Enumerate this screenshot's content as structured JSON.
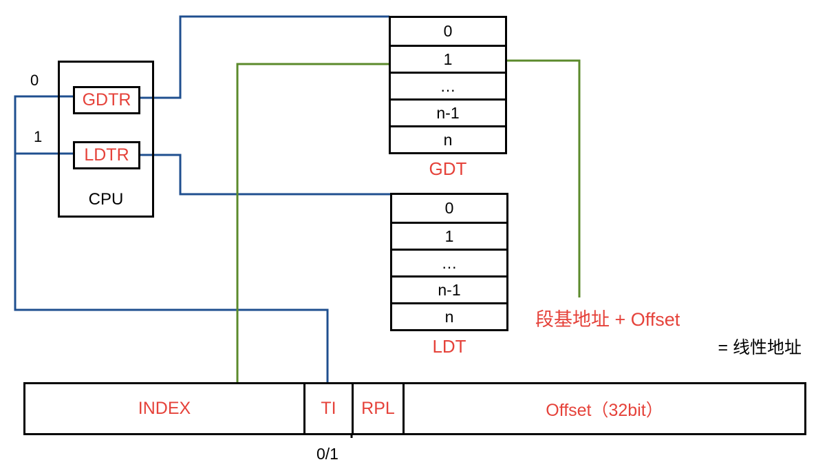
{
  "colors": {
    "label_red": "#e5423a",
    "pointer_blue": "#1f4f8f",
    "index_green": "#5b8a2b",
    "text_black": "#000000"
  },
  "cpu": {
    "label": "CPU",
    "gdtr": "GDTR",
    "ldtr": "LDTR",
    "gdtr_select": "0",
    "ldtr_select": "1"
  },
  "gdt": {
    "label": "GDT",
    "rows": [
      "0",
      "1",
      "…",
      "n-1",
      "n"
    ]
  },
  "ldt": {
    "label": "LDT",
    "rows": [
      "0",
      "1",
      "…",
      "n-1",
      "n"
    ]
  },
  "selector": {
    "index": "INDEX",
    "ti": "TI",
    "rpl": "RPL",
    "offset": "Offset（32bit）",
    "ti_values": "0/1"
  },
  "result": {
    "sum": "段基地址 + Offset",
    "equals": "= 线性地址"
  }
}
